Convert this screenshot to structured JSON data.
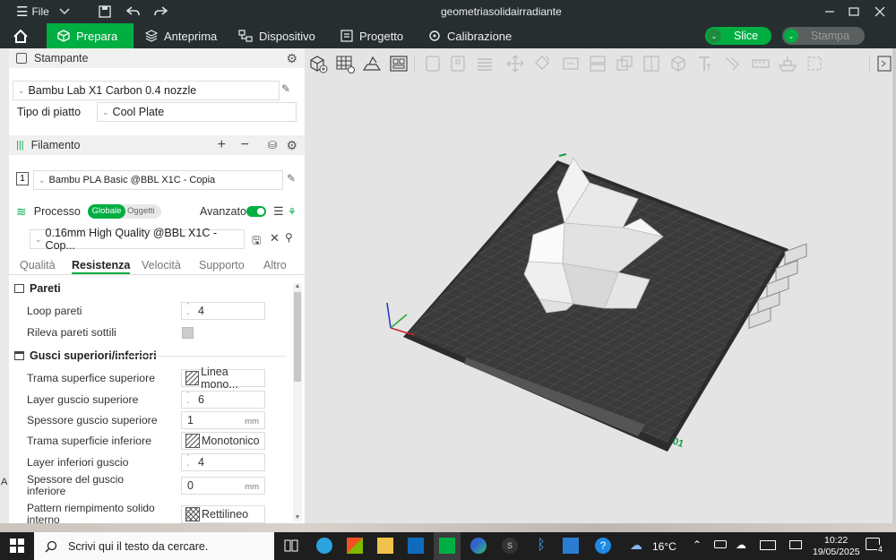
{
  "window": {
    "title": "geometriasolidairradiante",
    "menu_label": "File"
  },
  "nav": {
    "tabs": [
      {
        "label": "Prepara"
      },
      {
        "label": "Anteprima"
      },
      {
        "label": "Dispositivo"
      },
      {
        "label": "Progetto"
      },
      {
        "label": "Calibrazione"
      }
    ],
    "slice_label": "Slice",
    "print_label": "Stampa"
  },
  "printer": {
    "header": "Stampante",
    "name": "Bambu Lab X1 Carbon 0.4 nozzle",
    "plate_label": "Tipo di piatto",
    "plate_value": "Cool Plate"
  },
  "filament": {
    "header": "Filamento",
    "index": "1",
    "name": "Bambu PLA Basic @BBL X1C - Copia"
  },
  "process": {
    "header": "Processo",
    "toggle_global": "Globale",
    "toggle_objects": "Oggetti",
    "advanced_label": "Avanzato",
    "preset": "0.16mm High Quality @BBL X1C - Cop...",
    "tabs": [
      "Qualità",
      "Resistenza",
      "Velocità",
      "Supporto",
      "Altro"
    ]
  },
  "walls": {
    "header": "Pareti",
    "loop_label": "Loop pareti",
    "loop_value": "4",
    "thin_label": "Rileva pareti sottili"
  },
  "shells": {
    "header": "Gusci superiori/inferiori",
    "top_pattern_label": "Trama superfice superiore",
    "top_pattern_value": "Linea mono...",
    "top_layers_label": "Layer guscio superiore",
    "top_layers_value": "6",
    "top_thickness_label": "Spessore guscio superiore",
    "top_thickness_value": "1",
    "unit": "mm",
    "bottom_pattern_label": "Trama superficie inferiore",
    "bottom_pattern_value": "Monotonico",
    "bottom_layers_label": "Layer inferiori guscio",
    "bottom_layers_value": "4",
    "bottom_thickness_label_1": "Spessore del guscio",
    "bottom_thickness_label_2": "inferiore",
    "bottom_thickness_value": "0",
    "infill_label_1": "Pattern riempimento solido",
    "infill_label_2": "interno",
    "infill_value": "Rettilineo"
  },
  "plate": {
    "number": "01"
  },
  "taskbar": {
    "search_placeholder": "Scrivi qui il testo da cercare.",
    "weather": "16°C",
    "time": "10:22",
    "date": "19/05/2025",
    "notifications": "4"
  },
  "edge_text": "A",
  "colors": {
    "accent": "#00ae42",
    "titlebar": "#262e30",
    "viewport": "#e4e4e4"
  }
}
